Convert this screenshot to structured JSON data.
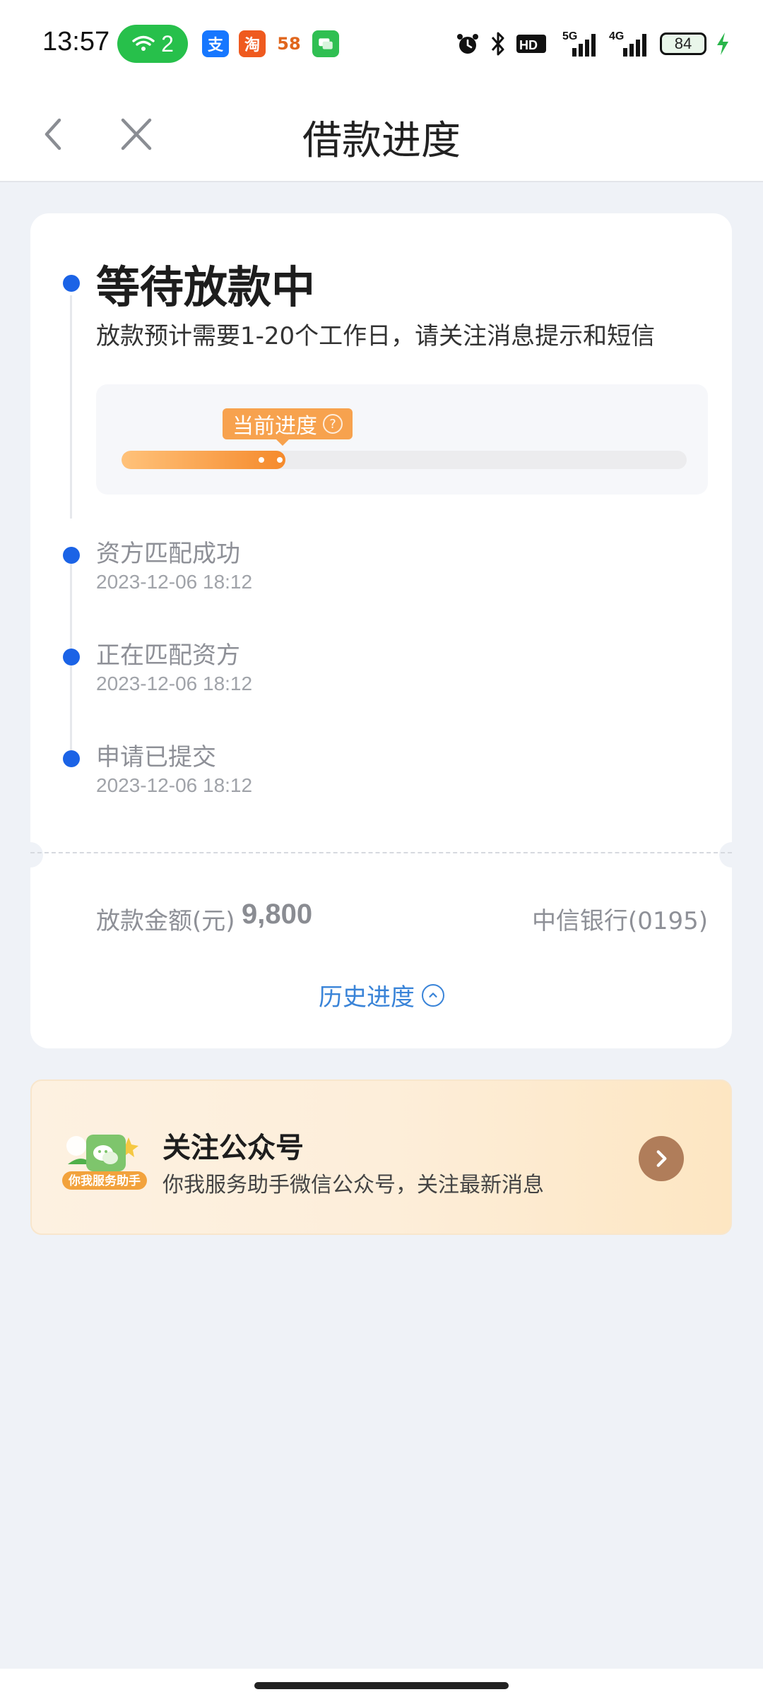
{
  "status_bar": {
    "time": "13:57",
    "hotspot_count": "2",
    "battery": "84",
    "apps": [
      "支",
      "淘",
      "58",
      "msg-icon"
    ],
    "signal_labels": [
      "5G",
      "4G"
    ]
  },
  "nav": {
    "title": "借款进度",
    "back_icon": "chevron-left-icon",
    "close_icon": "close-icon"
  },
  "current_status": {
    "title": "等待放款中",
    "description": "放款预计需要1-20个工作日，请关注消息提示和短信",
    "progress_label": "当前进度",
    "progress_fraction": 0.29
  },
  "timeline": [
    {
      "title": "资方匹配成功",
      "time": "2023-12-06 18:12"
    },
    {
      "title": "正在匹配资方",
      "time": "2023-12-06 18:12"
    },
    {
      "title": "申请已提交",
      "time": "2023-12-06 18:12"
    }
  ],
  "loan": {
    "amount_label": "放款金额(元)",
    "amount": "9,800",
    "bank": "中信银行(0195)",
    "history_label": "历史进度"
  },
  "promo": {
    "title": "关注公众号",
    "subtitle": "你我服务助手微信公众号，关注最新消息",
    "badge": "你我服务助手"
  },
  "colors": {
    "accent_blue": "#1b63e6",
    "progress_orange": "#f58a2c",
    "link_blue": "#3a84d8",
    "promo_button": "#b07d5a"
  }
}
